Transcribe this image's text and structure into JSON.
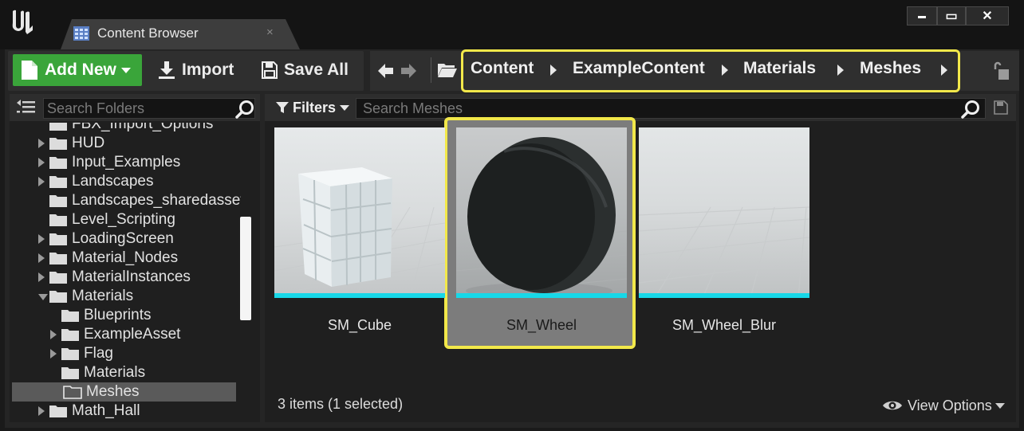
{
  "window": {
    "tab_title": "Content Browser",
    "tab_close": "×",
    "min_glyph": "▬",
    "max_glyph": "▭",
    "close_glyph": "✕"
  },
  "toolbar": {
    "add_new_label": "Add New",
    "import_label": "Import",
    "save_all_label": "Save All"
  },
  "breadcrumb": {
    "items": [
      "Content",
      "ExampleContent",
      "Materials",
      "Meshes"
    ]
  },
  "sources": {
    "search_placeholder": "Search Folders",
    "tree": [
      {
        "label": "FBX_Import_Options",
        "depth": 0,
        "expander": "none"
      },
      {
        "label": "HUD",
        "depth": 0,
        "expander": "closed"
      },
      {
        "label": "Input_Examples",
        "depth": 0,
        "expander": "closed"
      },
      {
        "label": "Landscapes",
        "depth": 0,
        "expander": "closed"
      },
      {
        "label": "Landscapes_sharedassets",
        "depth": 0,
        "expander": "none"
      },
      {
        "label": "Level_Scripting",
        "depth": 0,
        "expander": "none"
      },
      {
        "label": "LoadingScreen",
        "depth": 0,
        "expander": "closed"
      },
      {
        "label": "Material_Nodes",
        "depth": 0,
        "expander": "closed"
      },
      {
        "label": "MaterialInstances",
        "depth": 0,
        "expander": "closed"
      },
      {
        "label": "Materials",
        "depth": 0,
        "expander": "open"
      },
      {
        "label": "Blueprints",
        "depth": 1,
        "expander": "none"
      },
      {
        "label": "ExampleAsset",
        "depth": 1,
        "expander": "closed"
      },
      {
        "label": "Flag",
        "depth": 1,
        "expander": "closed"
      },
      {
        "label": "Materials",
        "depth": 1,
        "expander": "none"
      },
      {
        "label": "Meshes",
        "depth": 1,
        "expander": "none",
        "selected": true
      },
      {
        "label": "Math_Hall",
        "depth": 0,
        "expander": "closed"
      }
    ]
  },
  "assets": {
    "filters_label": "Filters",
    "search_placeholder": "Search Meshes",
    "items": [
      {
        "name": "SM_Cube",
        "selected": false
      },
      {
        "name": "SM_Wheel",
        "selected": true
      },
      {
        "name": "SM_Wheel_Blur",
        "selected": false
      }
    ],
    "status": "3 items (1 selected)",
    "view_options_label": "View Options"
  },
  "colors": {
    "accent_green": "#3aa53a",
    "highlight_yellow": "#f2e84a",
    "static_mesh_bar": "#17d8e8"
  }
}
